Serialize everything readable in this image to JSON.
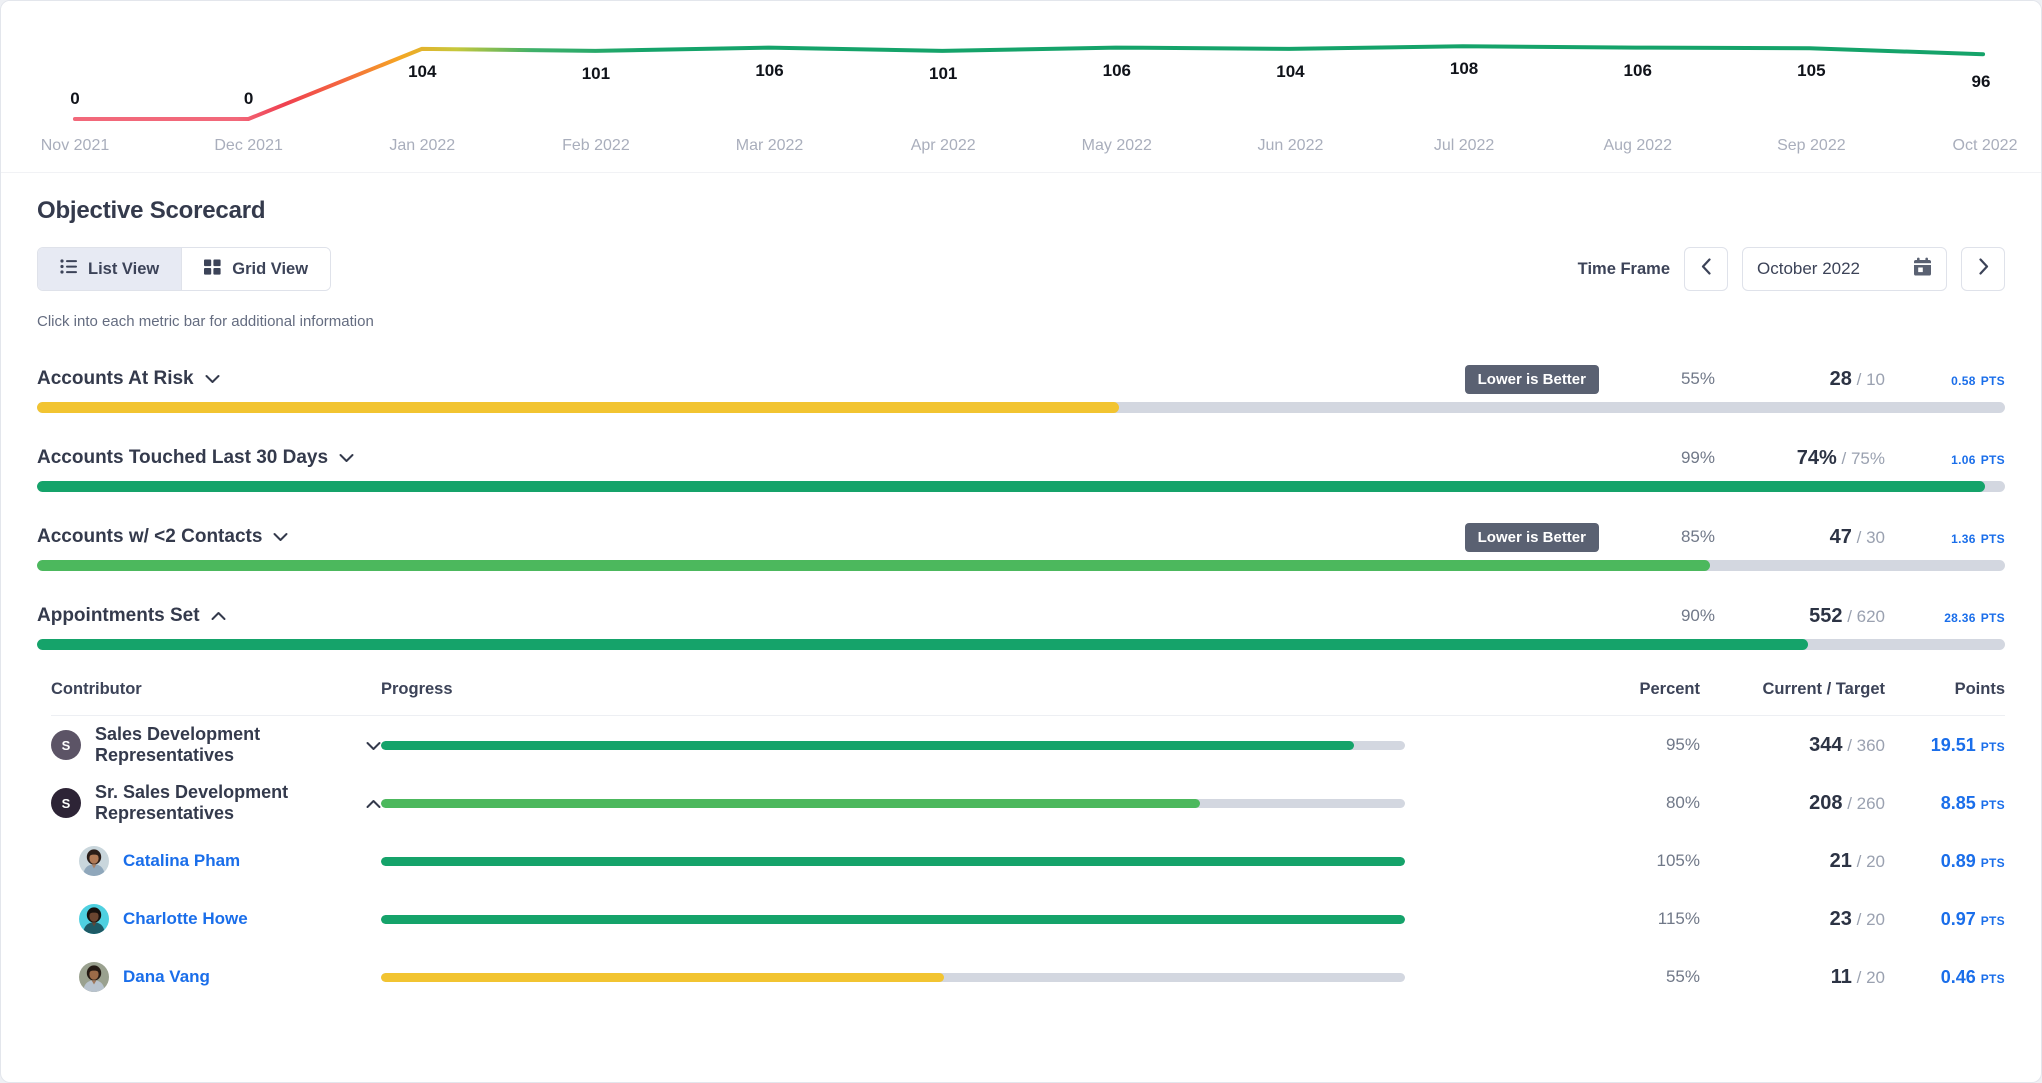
{
  "chart_data": {
    "type": "line",
    "title": "",
    "xlabel": "",
    "ylabel": "",
    "categories": [
      "Nov 2021",
      "Dec 2021",
      "Jan 2022",
      "Feb 2022",
      "Mar 2022",
      "Apr 2022",
      "May 2022",
      "Jun 2022",
      "Jul 2022",
      "Aug 2022",
      "Sep 2022",
      "Oct 2022"
    ],
    "values": [
      0,
      0,
      104,
      101,
      106,
      101,
      106,
      104,
      108,
      106,
      105,
      96
    ],
    "ylim": [
      0,
      120
    ],
    "grid": false,
    "legend": "none",
    "line_gradient": [
      "#ef4d5a",
      "#f4673f",
      "#f5a623",
      "#f2cf33",
      "#5cb85c",
      "#15a36a"
    ]
  },
  "header": {
    "title": "Objective Scorecard",
    "hint": "Click into each metric bar for additional information",
    "views": [
      {
        "label": "List View",
        "icon": "list-icon",
        "active": true
      },
      {
        "label": "Grid View",
        "icon": "grid-icon",
        "active": false
      }
    ],
    "time_frame": {
      "label": "Time Frame",
      "value": "October 2022",
      "prev_icon": "chevron-left-icon",
      "next_icon": "chevron-right-icon",
      "calendar_icon": "calendar-icon"
    }
  },
  "metrics": [
    {
      "name": "Accounts At Risk",
      "expanded": false,
      "badge": "Lower is Better",
      "percent": "55%",
      "current": "28",
      "target": "/ 10",
      "points": "0.58",
      "points_unit": "PTS",
      "fill_pct": 55,
      "fill_color": "#f2c431"
    },
    {
      "name": "Accounts Touched Last 30 Days",
      "expanded": false,
      "badge": "",
      "percent": "99%",
      "current": "74%",
      "target": "/ 75%",
      "points": "1.06",
      "points_unit": "PTS",
      "fill_pct": 99,
      "fill_color": "#15a36a"
    },
    {
      "name": "Accounts w/ <2 Contacts",
      "expanded": false,
      "badge": "Lower is Better",
      "percent": "85%",
      "current": "47",
      "target": "/ 30",
      "points": "1.36",
      "points_unit": "PTS",
      "fill_pct": 85,
      "fill_color": "#4cb85d"
    },
    {
      "name": "Appointments Set",
      "expanded": true,
      "badge": "",
      "percent": "90%",
      "current": "552",
      "target": "/ 620",
      "points": "28.36",
      "points_unit": "PTS",
      "fill_pct": 90,
      "fill_color": "#15a36a"
    }
  ],
  "table": {
    "columns": {
      "contributor": "Contributor",
      "progress": "Progress",
      "percent": "Percent",
      "current_target": "Current / Target",
      "points": "Points"
    },
    "rows": [
      {
        "type": "group",
        "name": "Sales Development Representatives",
        "initial": "S",
        "avatar_color": "#5c5466",
        "expanded": false,
        "percent": "95%",
        "current": "344",
        "target": "/ 360",
        "points": "19.51",
        "points_unit": "PTS",
        "fill_pct": 95,
        "fill_color": "#15a36a"
      },
      {
        "type": "group",
        "name": "Sr. Sales Development Representatives",
        "initial": "S",
        "avatar_color": "#2d2436",
        "expanded": true,
        "percent": "80%",
        "current": "208",
        "target": "/ 260",
        "points": "8.85",
        "points_unit": "PTS",
        "fill_pct": 80,
        "fill_color": "#4cb85d"
      },
      {
        "type": "person",
        "name": "Catalina Pham",
        "avatar": "photo-avatar-1",
        "percent": "105%",
        "current": "21",
        "target": "/ 20",
        "points": "0.89",
        "points_unit": "PTS",
        "fill_pct": 100,
        "fill_color": "#15a36a"
      },
      {
        "type": "person",
        "name": "Charlotte Howe",
        "avatar": "photo-avatar-2",
        "percent": "115%",
        "current": "23",
        "target": "/ 20",
        "points": "0.97",
        "points_unit": "PTS",
        "fill_pct": 100,
        "fill_color": "#15a36a"
      },
      {
        "type": "person",
        "name": "Dana Vang",
        "avatar": "photo-avatar-3",
        "percent": "55%",
        "current": "11",
        "target": "/ 20",
        "points": "0.46",
        "points_unit": "PTS",
        "fill_pct": 55,
        "fill_color": "#f2c431"
      }
    ]
  }
}
